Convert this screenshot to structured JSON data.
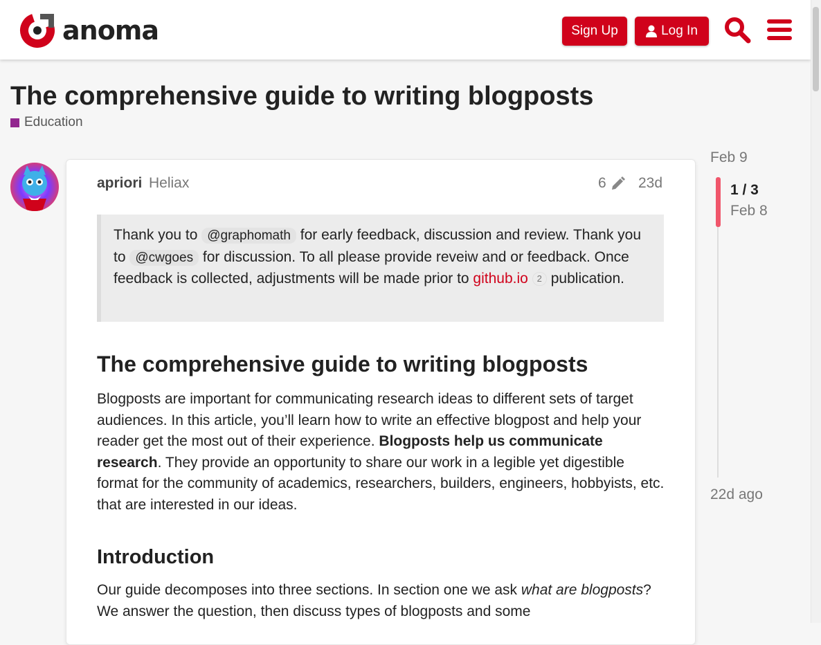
{
  "header": {
    "logo_text": "anoma",
    "signup_label": "Sign Up",
    "login_label": "Log In",
    "brand_color": "#d0021b",
    "icons": [
      "search-icon",
      "hamburger-menu-icon",
      "user-icon"
    ]
  },
  "topic": {
    "title": "The comprehensive guide to writing blogposts",
    "category": "Education",
    "category_color": "#92278f"
  },
  "post": {
    "username": "apriori",
    "user_title": "Heliax",
    "edit_count": "6",
    "age": "23d",
    "quote": {
      "t1": "Thank you to ",
      "mention1": "@graphomath",
      "t2": " for early feedback, discussion and review. Thank you to ",
      "mention2": "@cwgoes",
      "t3": " for discussion. To all please provide reveiw and or feedback. Once feedback is collected, adjustments will be made prior to ",
      "link_text": "github.io",
      "link_clicks": "2",
      "t4": " publication."
    },
    "heading": "The comprehensive guide to writing blogposts",
    "para1": {
      "t1": "Blogposts are important for communicating research ideas to different sets of target audiences. In this article, you’ll learn how to write an effective blogpost and help your reader get the most out of their experience. ",
      "bold": "Blogposts help us communicate research",
      "t2": ". They provide an opportunity to share our work in a legible yet digestible format for the community of academics, researchers, builders, engineers, hobbyists, etc. that are interested in our ideas."
    },
    "subheading": "Introduction",
    "para2": {
      "t1": "Our guide decomposes into three sections. In section one we ask ",
      "italic": "what are blogposts",
      "t2": "? We answer the question, then discuss types of blogposts and some"
    }
  },
  "timeline": {
    "top_date": "Feb 9",
    "position": "1 / 3",
    "current_date": "Feb 8",
    "bottom_date": "22d ago"
  }
}
